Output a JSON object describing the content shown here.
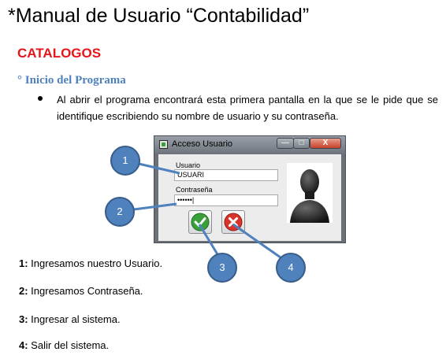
{
  "document": {
    "title": "*Manual de Usuario “Contabilidad”",
    "section": "CATALOGOS",
    "subsection": "° Inicio del Programa",
    "bullet": "Al abrir el programa encontrará esta primera pantalla en la que se le pide que se identifique escribiendo su nombre de usuario y su contraseña."
  },
  "dialog": {
    "title": "Acceso Usuario",
    "window_buttons": [
      "—",
      "□",
      "X"
    ],
    "user_label": "Usuario",
    "user_value": "USUARI",
    "password_label": "Contraseña",
    "password_value": "••••••|",
    "ok_icon": "check-icon",
    "cancel_icon": "x-icon",
    "avatar_icon": "user-silhouette-icon"
  },
  "callouts": [
    "1",
    "2",
    "3",
    "4"
  ],
  "steps": [
    {
      "num": "1:",
      "text": " Ingresamos nuestro Usuario."
    },
    {
      "num": "2:",
      "text": " Ingresamos Contraseña."
    },
    {
      "num": "3:",
      "text": " Ingresar al sistema."
    },
    {
      "num": "4:",
      "text": " Salir del sistema."
    }
  ],
  "colors": {
    "section": "#e8141b",
    "subsection": "#4f81bd",
    "callout": "#4f81bd",
    "ok": "#3aa03a",
    "cancel": "#d9342b"
  }
}
